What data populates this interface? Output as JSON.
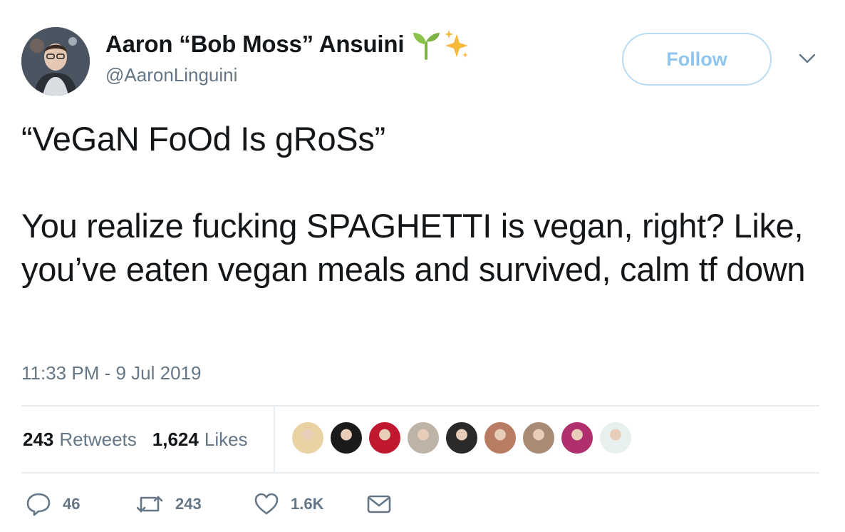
{
  "author": {
    "display_name": "Aaron “Bob Moss” Ansuini",
    "handle": "@AaronLinguini",
    "name_emojis": [
      "seedling-icon",
      "sparkles-icon"
    ]
  },
  "follow_button": {
    "label": "Follow"
  },
  "tweet": {
    "text": "“VeGaN FoOd Is gRoSs”\n\nYou realize fucking SPAGHETTI is vegan, right? Like, you’ve eaten vegan meals and survived, calm tf down",
    "timestamp": "11:33 PM - 9 Jul 2019"
  },
  "stats": {
    "retweets_count": "243",
    "retweets_label": "Retweets",
    "likes_count": "1,624",
    "likes_label": "Likes"
  },
  "liker_avatars": [
    {
      "color": "#e9d3a5"
    },
    {
      "color": "#1b1b1b"
    },
    {
      "color": "#c0182e"
    },
    {
      "color": "#bdb3a6"
    },
    {
      "color": "#2a2a2a"
    },
    {
      "color": "#b77c62"
    },
    {
      "color": "#a98a74"
    },
    {
      "color": "#b0306e"
    },
    {
      "color": "#e7f0ee"
    }
  ],
  "actions": {
    "reply_count": "46",
    "retweet_count": "243",
    "like_count": "1.6K"
  },
  "colors": {
    "text_primary": "#14171a",
    "text_secondary": "#657786",
    "follow_border": "#b9dcf5",
    "follow_text": "#8ec6f0",
    "divider": "#e6ecf0"
  }
}
